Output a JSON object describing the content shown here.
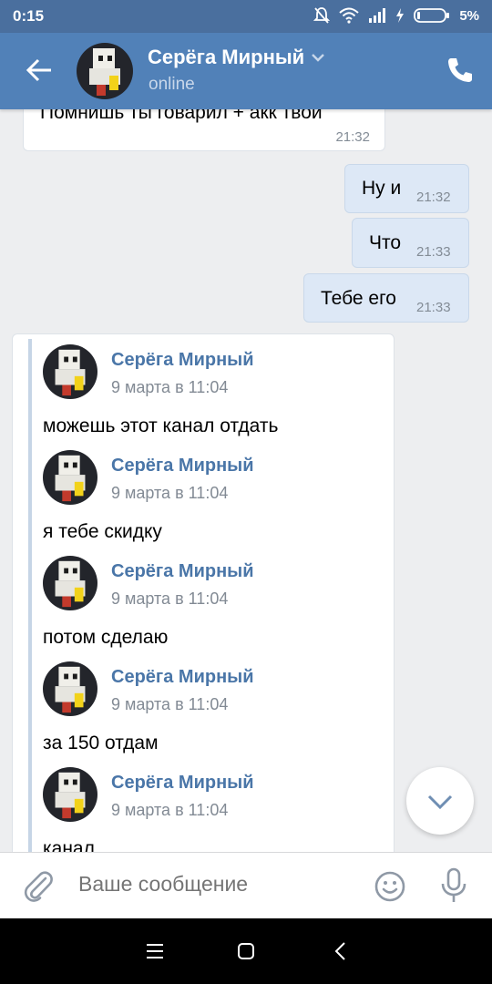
{
  "statusbar": {
    "time": "0:15",
    "battery": "5%"
  },
  "header": {
    "name": "Серёга Мирный",
    "status": "online"
  },
  "messages": [
    {
      "dir": "in",
      "text": "Помнишь ты говарил + акк твой",
      "time": "21:32"
    },
    {
      "dir": "out",
      "text": "Ну и",
      "time": "21:32"
    },
    {
      "dir": "out",
      "text": "Что",
      "time": "21:33"
    },
    {
      "dir": "out",
      "text": "Тебе его",
      "time": "21:33"
    }
  ],
  "forwarded": [
    {
      "author": "Серёга Мирный",
      "date": "9 марта в 11:04",
      "text": "можешь этот канал отдать"
    },
    {
      "author": "Серёга Мирный",
      "date": "9 марта в 11:04",
      "text": "я тебе скидку"
    },
    {
      "author": "Серёга Мирный",
      "date": "9 марта в 11:04",
      "text": "потом сделаю"
    },
    {
      "author": "Серёга Мирный",
      "date": "9 марта в 11:04",
      "text": "за 150 отдам"
    },
    {
      "author": "Серёга Мирный",
      "date": "9 марта в 11:04",
      "text": "канал"
    }
  ],
  "composer": {
    "placeholder": "Ваше сообщение"
  },
  "colors": {
    "header": "#5181b8",
    "statusbar": "#4a6f9e",
    "link": "#4a76a8",
    "out_bubble": "#dde8f6"
  }
}
